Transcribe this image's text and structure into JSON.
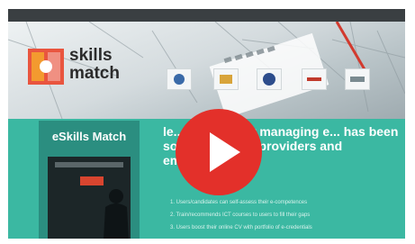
{
  "brand": {
    "line1": "skills",
    "line2": "match"
  },
  "panel": {
    "title": "eSkills Match"
  },
  "main": {
    "headline": "le... concept for managing e... has been so useful fo... g providers and employers",
    "bullets": [
      "1. Users/candidates can self-assess their e-competences",
      "2. Train/recommends ICT courses to users to fill their gaps",
      "3. Users boost their online CV with portfolio of e-credentials"
    ]
  },
  "video": {
    "play_icon": "play-icon",
    "color": "#e3302a"
  },
  "colors": {
    "teal": "#3bb8a2",
    "accent": "#e9553f"
  }
}
